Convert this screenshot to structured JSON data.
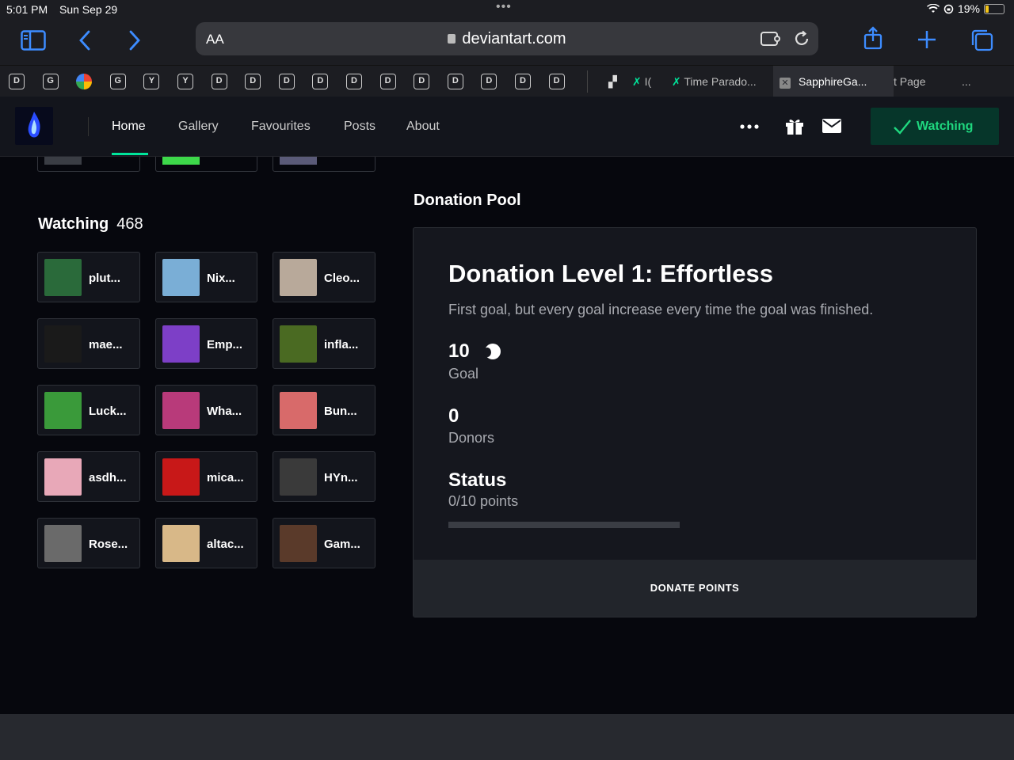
{
  "status_bar": {
    "time": "5:01 PM",
    "date": "Sun Sep 29",
    "battery": "19%",
    "battery_level": 0.19
  },
  "browser": {
    "text_size_label": "AA",
    "url": "deviantart.com",
    "favicons": [
      "D",
      "G",
      "G",
      "G",
      "Y",
      "Y",
      "D",
      "D",
      "D",
      "D",
      "D",
      "D",
      "D",
      "D",
      "D",
      "D",
      "D"
    ],
    "tabs": [
      {
        "label": "I("
      },
      {
        "label": "Time Parado..."
      },
      {
        "label": "SapphireGa..."
      },
      {
        "label": "t Page"
      },
      {
        "label": "..."
      }
    ]
  },
  "site_nav": {
    "links": [
      "Home",
      "Gallery",
      "Favourites",
      "Posts",
      "About"
    ],
    "watch_button": "Watching"
  },
  "watching": {
    "title": "Watching",
    "count": "468",
    "users": [
      {
        "name": "plut...",
        "color": "#2a6a3a"
      },
      {
        "name": "Nix...",
        "color": "#7aaed6"
      },
      {
        "name": "Cleo...",
        "color": "#b8a99a"
      },
      {
        "name": "mae...",
        "color": "#1a1a1a"
      },
      {
        "name": "Emp...",
        "color": "#7d3fc7"
      },
      {
        "name": "infla...",
        "color": "#4a6a22"
      },
      {
        "name": "Luck...",
        "color": "#3a9a3a"
      },
      {
        "name": "Wha...",
        "color": "#b83a7a"
      },
      {
        "name": "Bun...",
        "color": "#d86a6a"
      },
      {
        "name": "asdh...",
        "color": "#e8a8b8"
      },
      {
        "name": "mica...",
        "color": "#c81818"
      },
      {
        "name": "HYn...",
        "color": "#3a3a3a"
      },
      {
        "name": "Rose...",
        "color": "#6a6a6a"
      },
      {
        "name": "altac...",
        "color": "#d8b888"
      },
      {
        "name": "Gam...",
        "color": "#5a3a2a"
      }
    ]
  },
  "donation_pool": {
    "section_title": "Donation Pool",
    "level_title": "Donation Level 1: Effortless",
    "description": "First goal, but every goal increase every time the goal was finished.",
    "goal_value": "10",
    "goal_label": "Goal",
    "donors_value": "0",
    "donors_label": "Donors",
    "status_label": "Status",
    "status_value": "0/10 points",
    "progress": 0,
    "donate_button": "DONATE POINTS"
  }
}
